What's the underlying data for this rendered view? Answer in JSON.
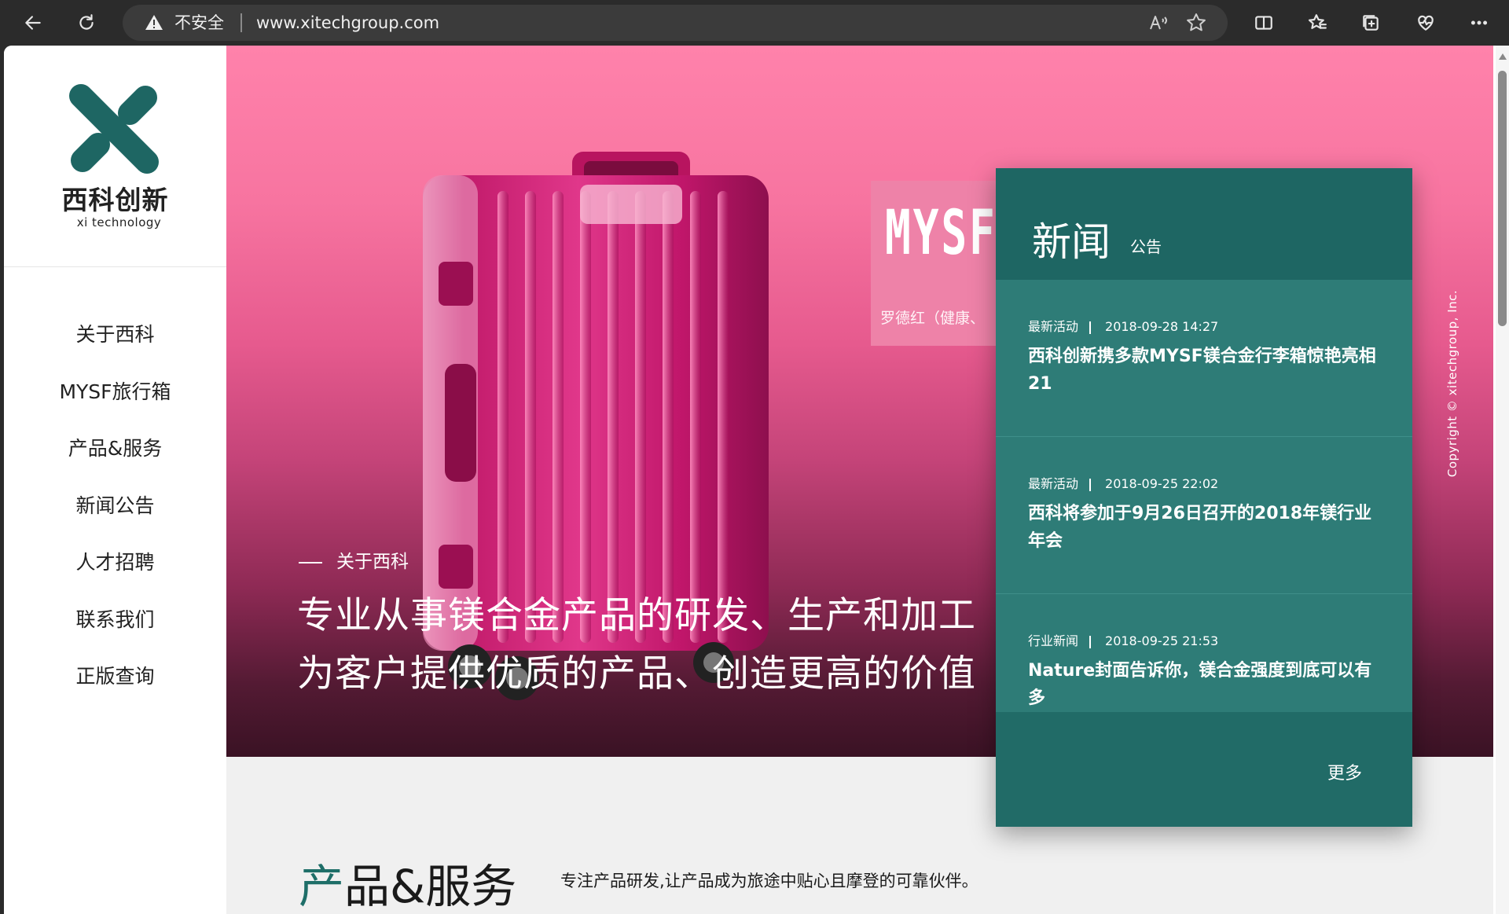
{
  "browser": {
    "security_label": "不安全",
    "url": "www.xitechgroup.com"
  },
  "sidebar": {
    "brand_name": "西科创新",
    "brand_sub": "xi  technology",
    "nav": [
      "关于西科",
      "MYSF旅行箱",
      "产品&服务",
      "新闻公告",
      "人才招聘",
      "联系我们",
      "正版查询"
    ]
  },
  "hero": {
    "section_label": "关于西科",
    "line1": "专业从事镁合金产品的研发、生产和加工",
    "line2": "为客户提供优质的产品、创造更高的价值",
    "product_card": {
      "logo_text": "MYSF",
      "caption": "罗德红（健康、"
    }
  },
  "news": {
    "title": "新闻",
    "tab": "公告",
    "items": [
      {
        "category": "最新活动",
        "date": "2018-09-28 14:27",
        "headline": "西科创新携多款MYSF镁合金行李箱惊艳亮相21"
      },
      {
        "category": "最新活动",
        "date": "2018-09-25 22:02",
        "headline": "西科将参加于9月26日召开的2018年镁行业年会"
      },
      {
        "category": "行业新闻",
        "date": "2018-09-25 21:53",
        "headline": "Nature封面告诉你，镁合金强度到底可以有多"
      }
    ],
    "more": "更多"
  },
  "copyright": "Copyright © xitechgroup, Inc.",
  "services": {
    "title_accent": "产",
    "title_rest": "品&服务",
    "description": "专注产品研发,让产品成为旅途中贴心且摩登的可靠伙伴。"
  },
  "colors": {
    "brand_teal": "#1e6663",
    "news_panel": "#216b67",
    "hero_pink": "#ff82ab"
  }
}
